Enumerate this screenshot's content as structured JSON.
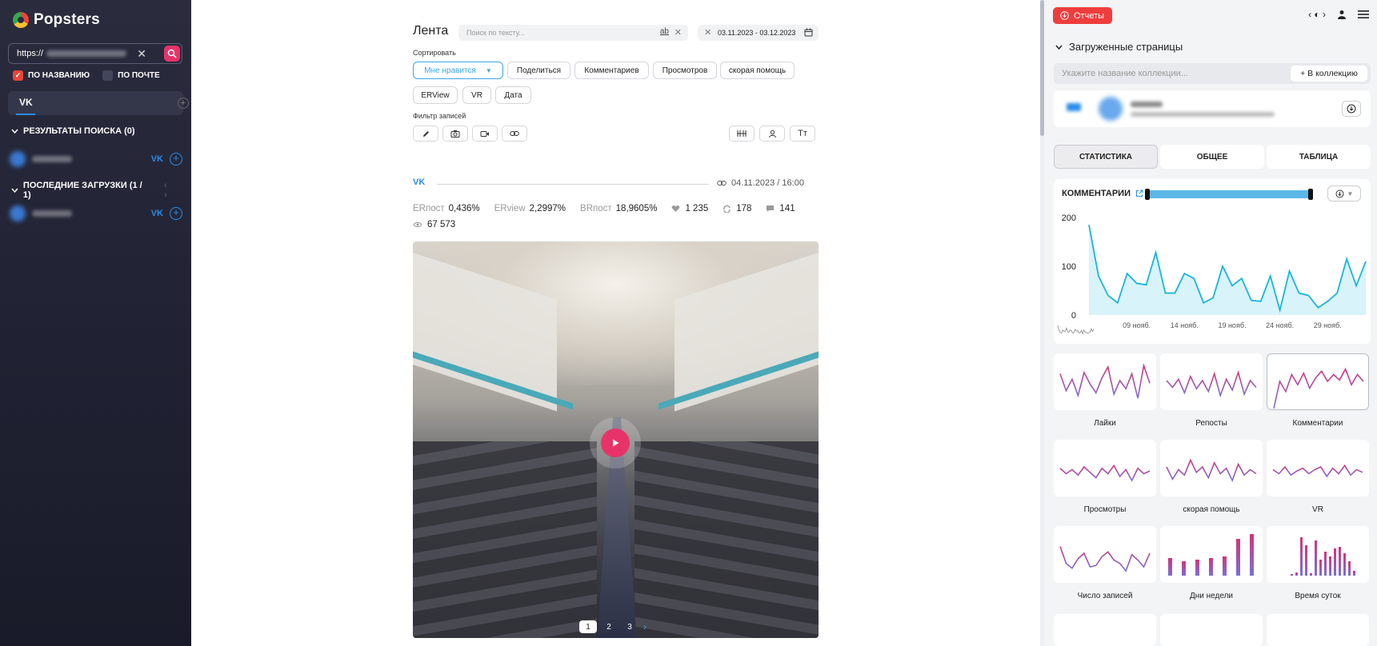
{
  "sidebar": {
    "brand": "Popsters",
    "url_value": "https://",
    "filters": [
      {
        "label": "ПО НАЗВАНИЮ",
        "checked": true
      },
      {
        "label": "ПО ПОЧТЕ",
        "checked": false
      }
    ],
    "network_tab": "VK",
    "search_results_title": "РЕЗУЛЬТАТЫ ПОИСКА (0)",
    "recent_title": "ПОСЛЕДНИЕ ЗАГРУЗКИ (1 / 1)",
    "vk_badge": "VK"
  },
  "feed": {
    "title": "Лента",
    "search_placeholder": "Поиск по тексту...",
    "search_ab": "ab",
    "date_range": "03.11.2023 - 03.12.2023",
    "sort_label": "Сортировать",
    "sort_options": [
      "Мне нравится",
      "Поделиться",
      "Комментариев",
      "Просмотров",
      "скорая помощь",
      "ERView",
      "VR",
      "Дата"
    ],
    "filter_label": "Фильтр записей",
    "text_size_icon_label": "Tт"
  },
  "post": {
    "network": "VK",
    "date": "04.11.2023 / 16:00",
    "metrics": [
      {
        "key": "ERпост",
        "value": "0,436%"
      },
      {
        "key": "ERview",
        "value": "2,2997%"
      },
      {
        "key": "ВRпост",
        "value": "18,9605%"
      }
    ],
    "likes": "1 235",
    "reposts": "178",
    "comments": "141",
    "views": "67 573",
    "pages": [
      "1",
      "2",
      "3"
    ],
    "current_page": "1"
  },
  "right": {
    "reports_label": "Отчеты",
    "loaded_pages_title": "Загруженные страницы",
    "collection_placeholder": "Укажите название коллекции...",
    "add_to_collection": "+ В коллекцию",
    "tabs": [
      "СТАТИСТИКА",
      "ОБЩЕЕ",
      "ТАБЛИЦА"
    ],
    "active_tab": "СТАТИСТИКА",
    "chart_title": "КОММЕНТАРИИ",
    "mini_charts": [
      "Лайки",
      "Репосты",
      "Комментарии",
      "Просмотры",
      "скорая помощь",
      "VR",
      "Число записей",
      "Дни недели",
      "Время суток"
    ]
  },
  "colors": {
    "accent_red": "#ee3d3d",
    "search_pink": "#e8336a",
    "vk_blue": "#2a8ce8",
    "chart_line": "#19b6d8",
    "chart_fill": "#d9f3fa",
    "spark_start": "#d1357a",
    "spark_end": "#7a6fd8"
  },
  "chart_data": {
    "type": "area",
    "title": "КОММЕНТАРИИ",
    "ylim": [
      0,
      200
    ],
    "yticks": [
      0,
      100,
      200
    ],
    "xticks": [
      "09 нояб.",
      "14 нояб.",
      "19 нояб.",
      "24 нояб.",
      "29 нояб."
    ],
    "x": [
      "04.11",
      "05.11",
      "06.11",
      "07.11",
      "08.11",
      "09.11",
      "10.11",
      "11.11",
      "12.11",
      "13.11",
      "14.11",
      "15.11",
      "16.11",
      "17.11",
      "18.11",
      "19.11",
      "20.11",
      "21.11",
      "22.11",
      "23.11",
      "24.11",
      "25.11",
      "26.11",
      "27.11",
      "28.11",
      "29.11",
      "30.11",
      "01.12",
      "02.12",
      "03.12"
    ],
    "values": [
      185,
      80,
      40,
      25,
      85,
      65,
      62,
      128,
      45,
      45,
      85,
      75,
      25,
      35,
      100,
      60,
      75,
      30,
      28,
      80,
      10,
      90,
      45,
      40,
      15,
      28,
      45,
      115,
      60,
      110
    ],
    "grid": false
  }
}
